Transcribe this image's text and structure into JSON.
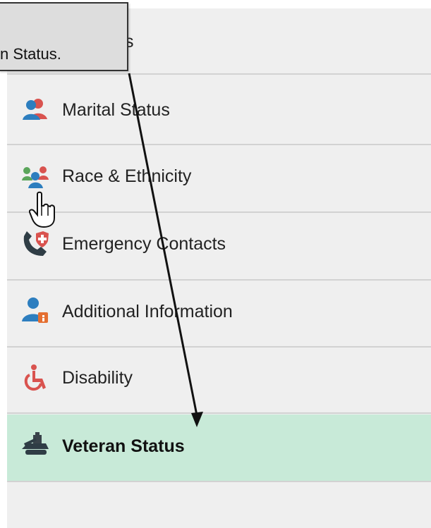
{
  "callout": {
    "text": "n Status."
  },
  "menu": {
    "items": [
      {
        "label": "ddresses",
        "icon": "addresses-icon",
        "active": false
      },
      {
        "label": "Marital Status",
        "icon": "marital-status-icon",
        "active": false
      },
      {
        "label": "Race & Ethnicity",
        "icon": "race-ethnicity-icon",
        "active": false
      },
      {
        "label": "Emergency Contacts",
        "icon": "emergency-contact-icon",
        "active": false
      },
      {
        "label": "Additional Information",
        "icon": "additional-information-icon",
        "active": false
      },
      {
        "label": "Disability",
        "icon": "wheelchair-icon",
        "active": false
      },
      {
        "label": "Veteran Status",
        "icon": "veteran-icon",
        "active": true
      }
    ]
  },
  "colors": {
    "menu_background": "#efefef",
    "active_background": "#c8ead8",
    "divider": "#d2d2d2",
    "icon_blue": "#2d7ebf",
    "icon_red": "#d9534f",
    "icon_green": "#5aa55a",
    "icon_dark": "#2f3d45",
    "callout_background": "#dddddd"
  },
  "cursor": {
    "icon": "hand-pointer-icon"
  }
}
